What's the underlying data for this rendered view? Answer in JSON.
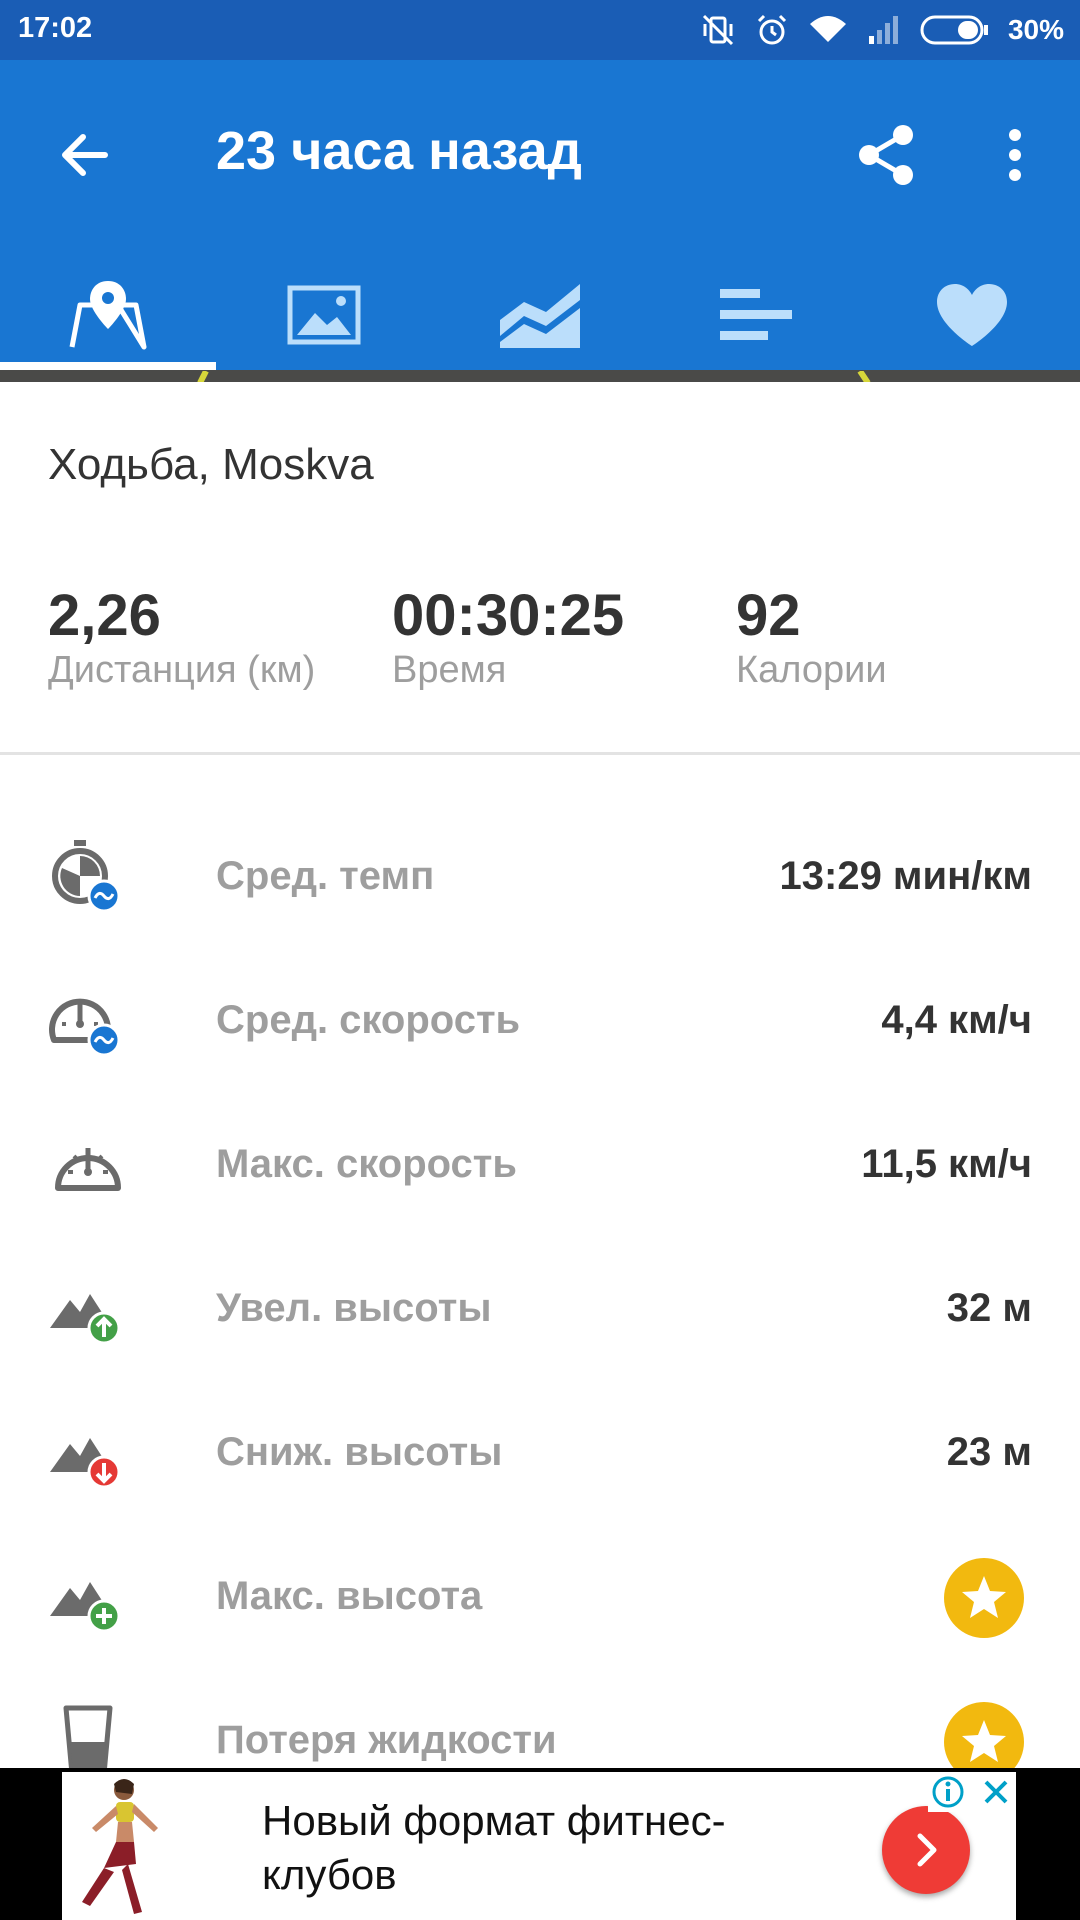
{
  "status_bar": {
    "time": "17:02",
    "battery": "30%",
    "icons": [
      "vibrate-off-icon",
      "alarm-icon",
      "wifi-icon",
      "signal-icon",
      "battery-icon"
    ]
  },
  "toolbar": {
    "title": "23 часа назад",
    "back_icon": "arrow-back-icon",
    "share_icon": "share-icon",
    "more_icon": "more-vert-icon"
  },
  "tabs": [
    {
      "icon": "map-pin-icon",
      "selected": true
    },
    {
      "icon": "photo-icon",
      "selected": false
    },
    {
      "icon": "chart-area-icon",
      "selected": false
    },
    {
      "icon": "splits-list-icon",
      "selected": false
    },
    {
      "icon": "heart-icon",
      "selected": false
    }
  ],
  "activity": {
    "title": "Ходьба, Moskva"
  },
  "summary": [
    {
      "value": "2,26",
      "label": "Дистанция (км)"
    },
    {
      "value": "00:30:25",
      "label": "Время"
    },
    {
      "value": "92",
      "label": "Калории"
    }
  ],
  "metrics": [
    {
      "icon": "avg-pace-icon",
      "label": "Сред. темп",
      "value": "13:29 мин/км"
    },
    {
      "icon": "avg-speed-icon",
      "label": "Сред. скорость",
      "value": "4,4 км/ч"
    },
    {
      "icon": "max-speed-icon",
      "label": "Макс. скорость",
      "value": "11,5 км/ч"
    },
    {
      "icon": "elevation-gain-icon",
      "label": "Увел. высоты",
      "value": "32 м"
    },
    {
      "icon": "elevation-loss-icon",
      "label": "Сниж. высоты",
      "value": "23 м"
    },
    {
      "icon": "max-elevation-icon",
      "label": "Макс. высота",
      "value": null,
      "premium_icon": "star-icon"
    },
    {
      "icon": "fluid-loss-icon",
      "label": "Потеря жидкости",
      "value": null,
      "premium_icon": "star-icon"
    }
  ],
  "ad": {
    "text": "Новый формат фитнес-клубов",
    "go_icon": "chevron-right-icon",
    "info_icon": "info-icon",
    "close_icon": "close-icon"
  },
  "colors": {
    "status_bar": "#1a5db5",
    "primary": "#1976d2",
    "tab_icon": "#bbdefb",
    "premium": "#f2b90f",
    "gain": "#43a047",
    "loss": "#e53935",
    "icon_gray": "#6b6b6b"
  }
}
